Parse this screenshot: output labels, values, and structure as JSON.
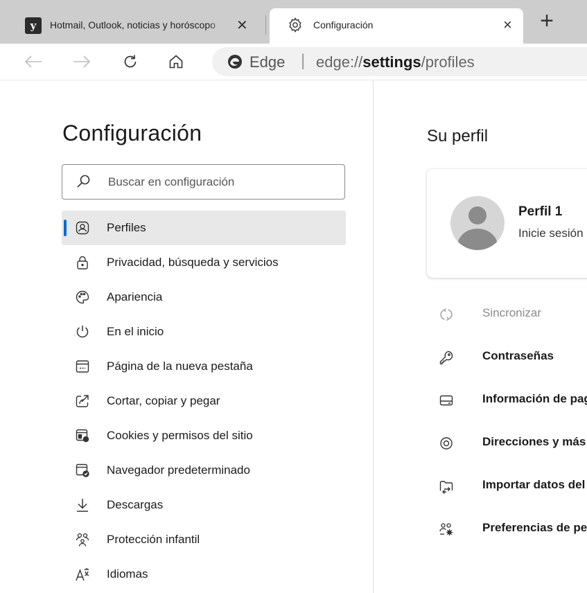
{
  "tabs": [
    {
      "title": "Hotmail, Outlook, noticias y horóscopo",
      "favicon": "msn-icon",
      "close": "✕"
    },
    {
      "title": "Configuración",
      "favicon": "gear-icon",
      "close": "×"
    }
  ],
  "new_tab_label": "+",
  "addressbar": {
    "brand": "Edge",
    "url_scheme": "edge://",
    "url_host": "settings",
    "url_path": "/profiles"
  },
  "sidebar": {
    "title": "Configuración",
    "search_placeholder": "Buscar en configuración",
    "items": [
      {
        "label": "Perfiles",
        "icon": "profiles-icon",
        "selected": true
      },
      {
        "label": "Privacidad, búsqueda y servicios",
        "icon": "lock-icon"
      },
      {
        "label": "Apariencia",
        "icon": "palette-icon"
      },
      {
        "label": "En el inicio",
        "icon": "power-icon"
      },
      {
        "label": "Página de la nueva pestaña",
        "icon": "new-tab-page-icon"
      },
      {
        "label": "Cortar, copiar y pegar",
        "icon": "share-icon"
      },
      {
        "label": "Cookies y permisos del sitio",
        "icon": "cookies-icon"
      },
      {
        "label": "Navegador predeterminado",
        "icon": "default-browser-icon"
      },
      {
        "label": "Descargas",
        "icon": "download-icon"
      },
      {
        "label": "Protección infantil",
        "icon": "family-icon"
      },
      {
        "label": "Idiomas",
        "icon": "languages-icon"
      }
    ]
  },
  "main": {
    "title": "Su perfil",
    "profile": {
      "name": "Perfil 1",
      "subtitle": "Inicie sesión para sincronizar"
    },
    "options": [
      {
        "label": "Sincronizar",
        "icon": "sync-icon",
        "disabled": true
      },
      {
        "label": "Contraseñas",
        "icon": "key-icon"
      },
      {
        "label": "Información de pago",
        "icon": "card-icon"
      },
      {
        "label": "Direcciones y más",
        "icon": "location-icon"
      },
      {
        "label": "Importar datos del explorador",
        "icon": "import-icon"
      },
      {
        "label": "Preferencias de perfil",
        "icon": "profile-prefs-icon"
      }
    ]
  },
  "colors": {
    "accent": "#0a6cd6",
    "tabstrip": "#cdcdcd",
    "selected_bg": "#e8e8e8"
  }
}
